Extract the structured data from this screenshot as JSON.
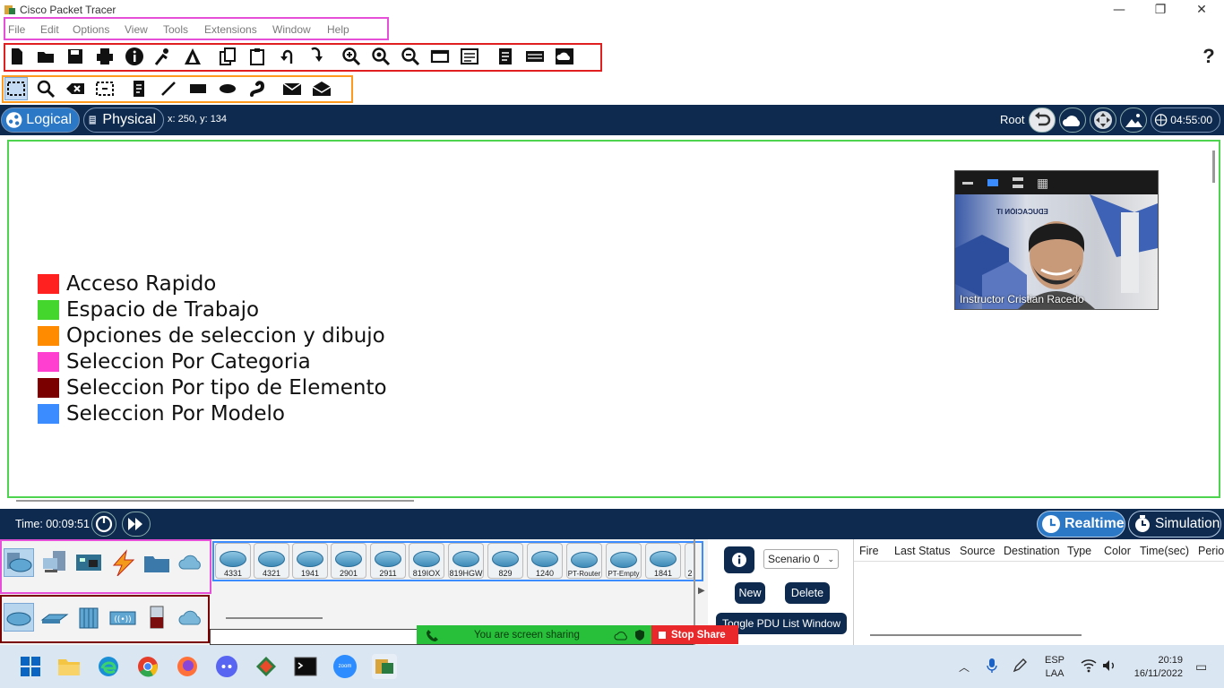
{
  "window": {
    "title": "Cisco Packet Tracer",
    "minimize": "—",
    "maximize": "❐",
    "close": "✕"
  },
  "menu": [
    "File",
    "Edit",
    "Options",
    "View",
    "Tools",
    "Extensions",
    "Window",
    "Help"
  ],
  "help_glyph": "?",
  "logical_bar": {
    "logical_label": "Logical",
    "physical_label": "Physical",
    "coords": "x: 250, y: 134",
    "root_label": "Root",
    "clock": "04:55:00"
  },
  "legend": [
    {
      "label": "Acceso Rapido",
      "color": "#ff2020"
    },
    {
      "label": "Espacio de Trabajo",
      "color": "#44d62c"
    },
    {
      "label": "Opciones de seleccion y dibujo",
      "color": "#ff8c00"
    },
    {
      "label": "Seleccion Por Categoria",
      "color": "#ff3fd0"
    },
    {
      "label": "Seleccion Por tipo de Elemento",
      "color": "#7a0000"
    },
    {
      "label": "Seleccion Por Modelo",
      "color": "#3a8cff"
    }
  ],
  "video": {
    "caption": "Instructor Cristian Racedo",
    "banner_text": "EDUCACIÓN IT"
  },
  "time_bar": {
    "time_label": "Time: 00:09:51",
    "realtime_label": "Realtime",
    "simulation_label": "Simulation"
  },
  "models": [
    "4331",
    "4321",
    "1941",
    "2901",
    "2911",
    "819IOX",
    "819HGW",
    "829",
    "1240",
    "PT-Router",
    "PT-Empty",
    "1841",
    "2"
  ],
  "sim": {
    "scenario": "Scenario 0",
    "new_label": "New",
    "delete_label": "Delete",
    "toggle_label": "Toggle PDU List Window"
  },
  "pdu_columns": [
    "Fire",
    "Last Status",
    "Source",
    "Destination",
    "Type",
    "Color",
    "Time(sec)",
    "Perio"
  ],
  "screen_share": {
    "message": "You are screen sharing",
    "stop_label": "Stop Share"
  },
  "taskbar": {
    "lang_top": "ESP",
    "lang_bottom": "LAA",
    "time": "20:19",
    "date": "16/11/2022",
    "zoom_label": "zoom"
  },
  "colors": {
    "accent_navy": "#0e2b4f",
    "frame_pink": "#e64fd8",
    "frame_red": "#e02020",
    "frame_orange": "#ff9a1f",
    "frame_green": "#4ed44e",
    "frame_blue": "#3a8cff",
    "frame_maroon": "#7a0000"
  }
}
